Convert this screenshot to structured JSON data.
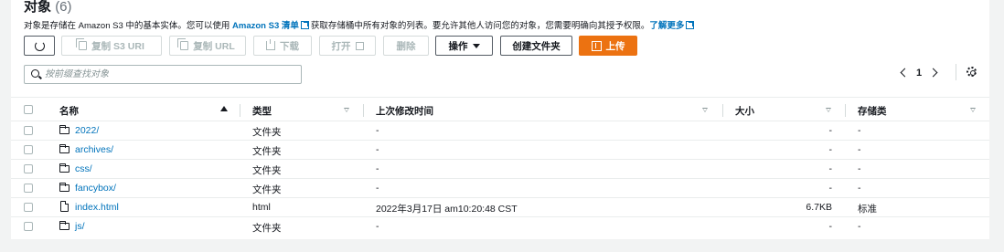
{
  "header": {
    "title": "对象",
    "count": "(6)"
  },
  "description": {
    "part1": "对象是存储在 Amazon S3 中的基本实体。您可以使用 ",
    "link1": "Amazon S3 清单",
    "part2": "获取存储桶中所有对象的列表。要允许其他人访问您的对象，您需要明确向其授予权限。",
    "link2": "了解更多"
  },
  "toolbar": {
    "copy_s3_uri": "复制 S3 URI",
    "copy_url": "复制 URL",
    "download": "下载",
    "open": "打开",
    "delete": "删除",
    "actions": "操作",
    "create_folder": "创建文件夹",
    "upload": "上传"
  },
  "search": {
    "placeholder": "按前缀查找对象",
    "value": ""
  },
  "pagination": {
    "current_page": "1"
  },
  "table": {
    "columns": [
      "名称",
      "类型",
      "上次修改时间",
      "大小",
      "存储类"
    ],
    "rows": [
      {
        "name": "2022/",
        "kind": "folder",
        "type": "文件夹",
        "modified": "-",
        "size": "-",
        "storage": "-"
      },
      {
        "name": "archives/",
        "kind": "folder",
        "type": "文件夹",
        "modified": "-",
        "size": "-",
        "storage": "-"
      },
      {
        "name": "css/",
        "kind": "folder",
        "type": "文件夹",
        "modified": "-",
        "size": "-",
        "storage": "-"
      },
      {
        "name": "fancybox/",
        "kind": "folder",
        "type": "文件夹",
        "modified": "-",
        "size": "-",
        "storage": "-"
      },
      {
        "name": "index.html",
        "kind": "file",
        "type": "html",
        "modified": "2022年3月17日 am10:20:48 CST",
        "size": "6.7KB",
        "storage": "标准"
      },
      {
        "name": "js/",
        "kind": "folder",
        "type": "文件夹",
        "modified": "-",
        "size": "-",
        "storage": "-"
      }
    ]
  },
  "colors": {
    "link": "#0073bb",
    "primary": "#ec7211",
    "disabled": "#aab7b8"
  },
  "icons": [
    "refresh-icon",
    "copy-icon",
    "download-icon",
    "external-link-icon",
    "caret-down-icon",
    "upload-icon",
    "search-icon",
    "chevron-left-icon",
    "chevron-right-icon",
    "gear-icon",
    "folder-icon",
    "file-icon",
    "sort-asc-icon",
    "sort-icon"
  ]
}
